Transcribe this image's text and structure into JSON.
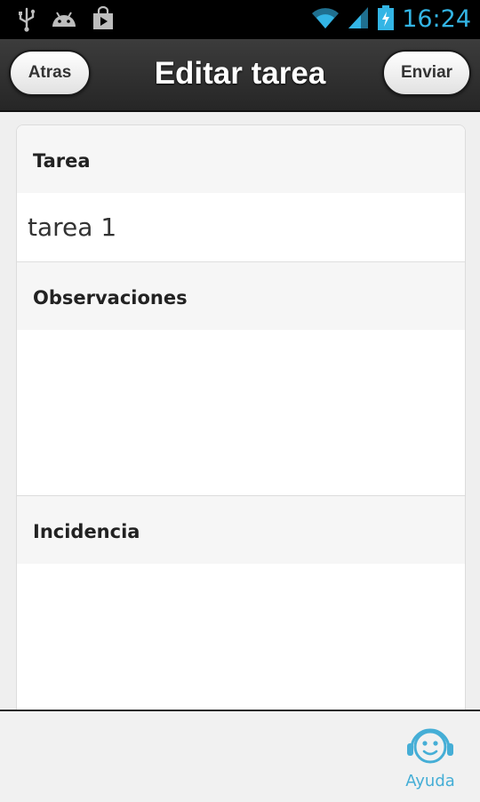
{
  "status_bar": {
    "icons_left": [
      "usb-icon",
      "android-debug-icon",
      "play-store-icon"
    ],
    "icons_right": [
      "wifi-icon",
      "signal-icon",
      "battery-icon"
    ],
    "time": "16:24",
    "accent_color": "#33b5e5"
  },
  "header": {
    "title": "Editar tarea",
    "back_label": "Atras",
    "send_label": "Enviar"
  },
  "form": {
    "task": {
      "label": "Tarea",
      "value": "tarea 1"
    },
    "observations": {
      "label": "Observaciones",
      "value": ""
    },
    "incident": {
      "label": "Incidencia",
      "value": ""
    }
  },
  "footer": {
    "help_label": "Ayuda",
    "help_color": "#45aed6"
  }
}
